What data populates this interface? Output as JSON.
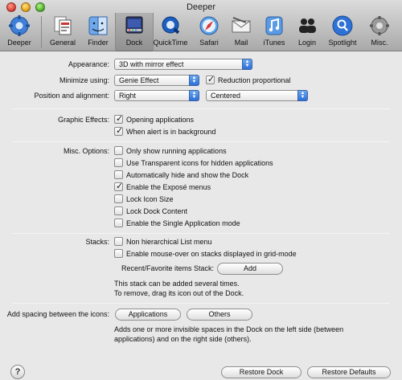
{
  "window": {
    "title": "Deeper"
  },
  "toolbar": {
    "items": [
      {
        "label": "Deeper",
        "icon": "gear-icon"
      },
      {
        "label": "General",
        "icon": "general-icon"
      },
      {
        "label": "Finder",
        "icon": "finder-icon"
      },
      {
        "label": "Dock",
        "icon": "dock-icon"
      },
      {
        "label": "QuickTime",
        "icon": "quicktime-icon"
      },
      {
        "label": "Safari",
        "icon": "safari-icon"
      },
      {
        "label": "Mail",
        "icon": "mail-icon"
      },
      {
        "label": "iTunes",
        "icon": "itunes-icon"
      },
      {
        "label": "Login",
        "icon": "login-icon"
      },
      {
        "label": "Spotlight",
        "icon": "spotlight-icon"
      },
      {
        "label": "Misc.",
        "icon": "misc-icon"
      }
    ],
    "active": "Dock"
  },
  "appearance": {
    "label": "Appearance:",
    "value": "3D with mirror effect"
  },
  "minimize": {
    "label": "Minimize using:",
    "value": "Genie Effect",
    "reduction_label": "Reduction proportional",
    "reduction_checked": true
  },
  "position": {
    "label": "Position and alignment:",
    "position_value": "Right",
    "alignment_value": "Centered"
  },
  "graphic_effects": {
    "label": "Graphic Effects:",
    "options": [
      {
        "label": "Opening applications",
        "checked": true
      },
      {
        "label": "When alert is in background",
        "checked": true
      }
    ]
  },
  "misc_options": {
    "label": "Misc. Options:",
    "options": [
      {
        "label": "Only show running applications",
        "checked": false
      },
      {
        "label": "Use Transparent icons for hidden applications",
        "checked": false
      },
      {
        "label": "Automatically hide and show the Dock",
        "checked": false
      },
      {
        "label": "Enable the Exposé menus",
        "checked": true
      },
      {
        "label": "Lock Icon Size",
        "checked": false
      },
      {
        "label": "Lock Dock Content",
        "checked": false
      },
      {
        "label": "Enable the Single Application mode",
        "checked": false
      }
    ]
  },
  "stacks": {
    "label": "Stacks:",
    "options": [
      {
        "label": "Non hierarchical List menu",
        "checked": false
      },
      {
        "label": "Enable mouse-over on stacks displayed in grid-mode",
        "checked": false
      }
    ],
    "recent_label": "Recent/Favorite items Stack:",
    "add_button": "Add",
    "note_line1": "This stack can be added several times.",
    "note_line2": "To remove, drag its icon out of the Dock."
  },
  "spacing": {
    "label": "Add spacing between the icons:",
    "applications_button": "Applications",
    "others_button": "Others",
    "note_line1": "Adds one or more invisible spaces in the Dock on the left side (between",
    "note_line2": "applications) and on the right side (others)."
  },
  "footer": {
    "help_glyph": "?",
    "restore_dock": "Restore Dock",
    "restore_defaults": "Restore Defaults"
  },
  "colors": {
    "accent": "#2d6fd8",
    "background": "#e8e8e8"
  }
}
